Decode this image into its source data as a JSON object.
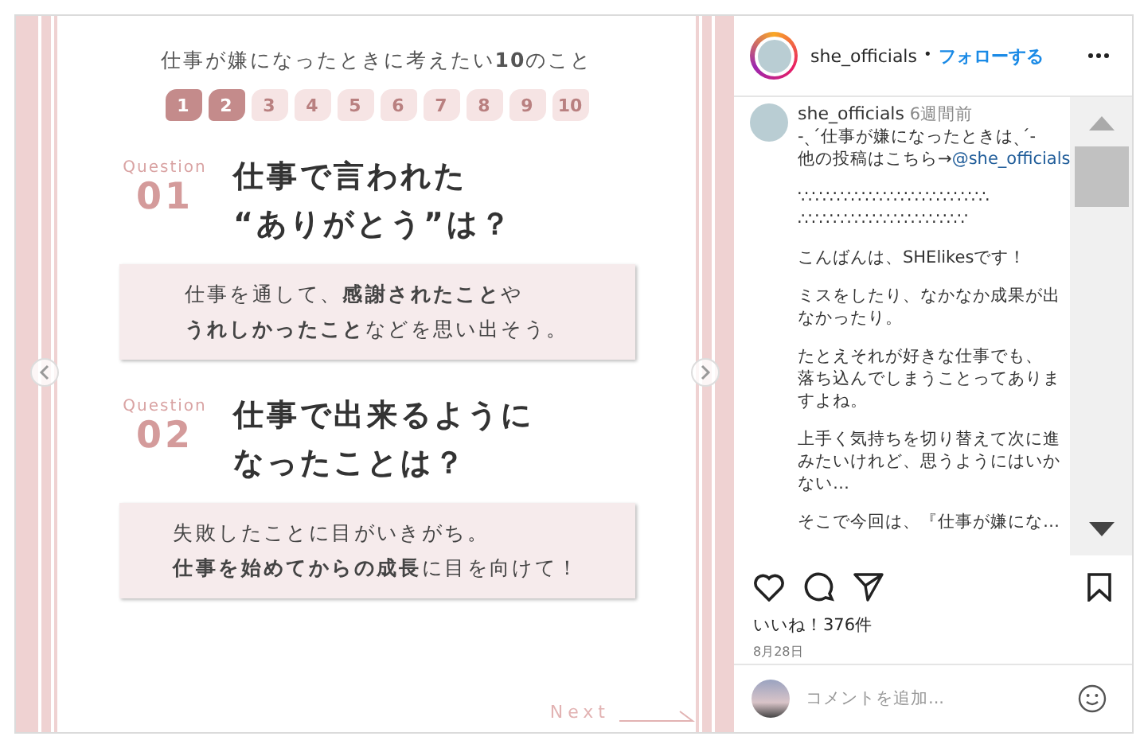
{
  "post": {
    "title": "仕事が嫌になったときに考えたい**10**のこと",
    "pages": [
      {
        "label": "1",
        "filled": true
      },
      {
        "label": "2",
        "filled": true
      },
      {
        "label": "3",
        "filled": false
      },
      {
        "label": "4",
        "filled": false
      },
      {
        "label": "5",
        "filled": false
      },
      {
        "label": "6",
        "filled": false
      },
      {
        "label": "7",
        "filled": false
      },
      {
        "label": "8",
        "filled": false
      },
      {
        "label": "9",
        "filled": false
      },
      {
        "label": "10",
        "filled": false
      }
    ],
    "questions": [
      {
        "tag": "Question",
        "number": "01",
        "heading": [
          "仕事で言われた",
          "“ありがとう”は？"
        ],
        "answer": [
          "仕事を通して、**感謝されたこと**や",
          "**うれしかったこと**などを思い出そう。"
        ]
      },
      {
        "tag": "Question",
        "number": "02",
        "heading": [
          "仕事で出来るように",
          "なったことは？"
        ],
        "answer": [
          "失敗したことに目がいきがち。",
          "**仕事を始めてからの成長**に目を向けて！"
        ]
      }
    ],
    "next": "Next"
  },
  "header": {
    "username": "she_officials",
    "separator": "•",
    "follow": "フォローする"
  },
  "caption": {
    "username": "she_officials",
    "time": "6週間前",
    "lines": [
      "-ˎˊ仕事が嫌になったときはˎˊ-"
    ],
    "link_prefix": "他の投稿はこちら→",
    "link": "@she_officials",
    "paragraphs": [
      [
        "∵∴∵∴∵∴∵∴∵∴∵∴∵∴∵∴∵∴",
        "∴∵∴∵∴∵∴∵∴∵∴∵∴∵∴∵"
      ],
      [
        "こんばんは、SHElikesです！"
      ],
      [
        "ミスをしたり、なかなか成果が出",
        "なかったり。"
      ],
      [
        "たとえそれが好きな仕事でも、",
        "落ち込んでしまうことってありま",
        "すよね。"
      ],
      [
        "上手く気持ちを切り替えて次に進",
        "みたいけれど、思うようにはいか",
        "ない…"
      ],
      [
        "そこで今回は、『仕事が嫌にな…"
      ]
    ]
  },
  "likes": "いいね！376件",
  "date": "8月28日",
  "comment": {
    "placeholder": "コメントを追加..."
  }
}
